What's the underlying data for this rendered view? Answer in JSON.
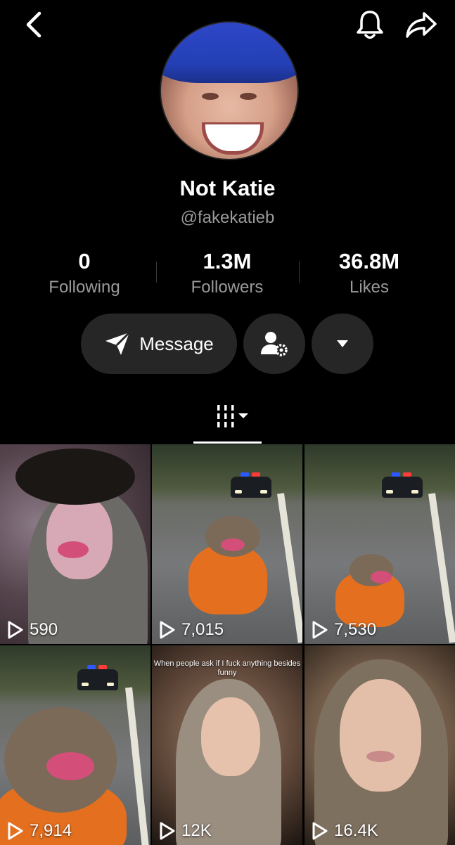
{
  "profile": {
    "name": "Not Katie",
    "handle": "@fakekatieb"
  },
  "stats": [
    {
      "value": "0",
      "label": "Following"
    },
    {
      "value": "1.3M",
      "label": "Followers"
    },
    {
      "value": "36.8M",
      "label": "Likes"
    }
  ],
  "actions": {
    "message_label": "Message"
  },
  "videos": [
    {
      "views": "590"
    },
    {
      "views": "7,015"
    },
    {
      "views": "7,530"
    },
    {
      "views": "7,914"
    },
    {
      "views": "12K",
      "caption": "When people ask if I fuck anything besides funny"
    },
    {
      "views": "16.4K"
    }
  ],
  "icons": {
    "back": "chevron-left-icon",
    "bell": "bell-icon",
    "share": "share-arrow-icon",
    "message": "paper-plane-icon",
    "add_friend": "person-gear-icon",
    "more": "caret-down-icon",
    "videos_tab": "grid-lines-icon",
    "play": "play-outline-icon"
  }
}
